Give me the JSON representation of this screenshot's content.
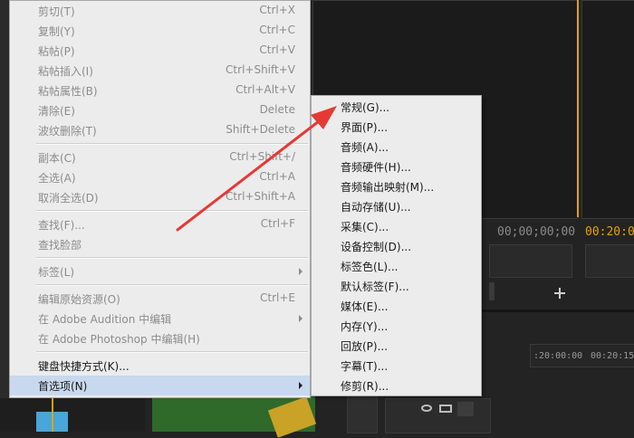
{
  "context_menu": {
    "items": [
      {
        "label": "剪切(T)",
        "shortcut": "Ctrl+X",
        "enabled": false
      },
      {
        "label": "复制(Y)",
        "shortcut": "Ctrl+C",
        "enabled": false
      },
      {
        "label": "粘帖(P)",
        "shortcut": "Ctrl+V",
        "enabled": false
      },
      {
        "label": "粘帖插入(I)",
        "shortcut": "Ctrl+Shift+V",
        "enabled": false
      },
      {
        "label": "粘帖属性(B)",
        "shortcut": "Ctrl+Alt+V",
        "enabled": false
      },
      {
        "label": "清除(E)",
        "shortcut": "Delete",
        "enabled": false
      },
      {
        "label": "波纹删除(T)",
        "shortcut": "Shift+Delete",
        "enabled": false
      },
      {
        "label": "副本(C)",
        "shortcut": "Ctrl+Shift+/",
        "enabled": false
      },
      {
        "label": "全选(A)",
        "shortcut": "Ctrl+A",
        "enabled": false
      },
      {
        "label": "取消全选(D)",
        "shortcut": "Ctrl+Shift+A",
        "enabled": false
      },
      {
        "label": "查找(F)...",
        "shortcut": "Ctrl+F",
        "enabled": false
      },
      {
        "label": "查找脸部",
        "shortcut": "",
        "enabled": false
      },
      {
        "label": "标签(L)",
        "shortcut": "",
        "enabled": false
      },
      {
        "label": "编辑原始资源(O)",
        "shortcut": "Ctrl+E",
        "enabled": false
      },
      {
        "label": "在 Adobe Audition 中编辑",
        "shortcut": "",
        "enabled": false
      },
      {
        "label": "在 Adobe Photoshop 中编辑(H)",
        "shortcut": "",
        "enabled": false
      },
      {
        "label": "键盘快捷方式(K)...",
        "shortcut": "",
        "enabled": true
      },
      {
        "label": "首选项(N)",
        "shortcut": "",
        "enabled": true
      }
    ]
  },
  "preferences_submenu": {
    "items": [
      "常规(G)...",
      "界面(P)...",
      "音频(A)...",
      "音频硬件(H)...",
      "音频输出映射(M)...",
      "自动存储(U)...",
      "采集(C)...",
      "设备控制(D)...",
      "标签色(L)...",
      "默认标签(F)...",
      "媒体(E)...",
      "内存(Y)...",
      "回放(P)...",
      "字幕(T)...",
      "修剪(R)..."
    ]
  },
  "monitor": {
    "timecode_left": "00;00;00;00",
    "timecode_right": "00:20:0"
  },
  "timeline": {
    "ruler_1": ":20:00:00",
    "ruler_2": "00:20:15"
  },
  "colors": {
    "annotation_arrow": "#e53935",
    "highlight": "#c8d8ee",
    "timecode_active": "#e8a100"
  },
  "icons": [
    "submenu-arrow-icon",
    "add-icon",
    "eye-icon",
    "film-icon",
    "clip-thumbnail"
  ]
}
